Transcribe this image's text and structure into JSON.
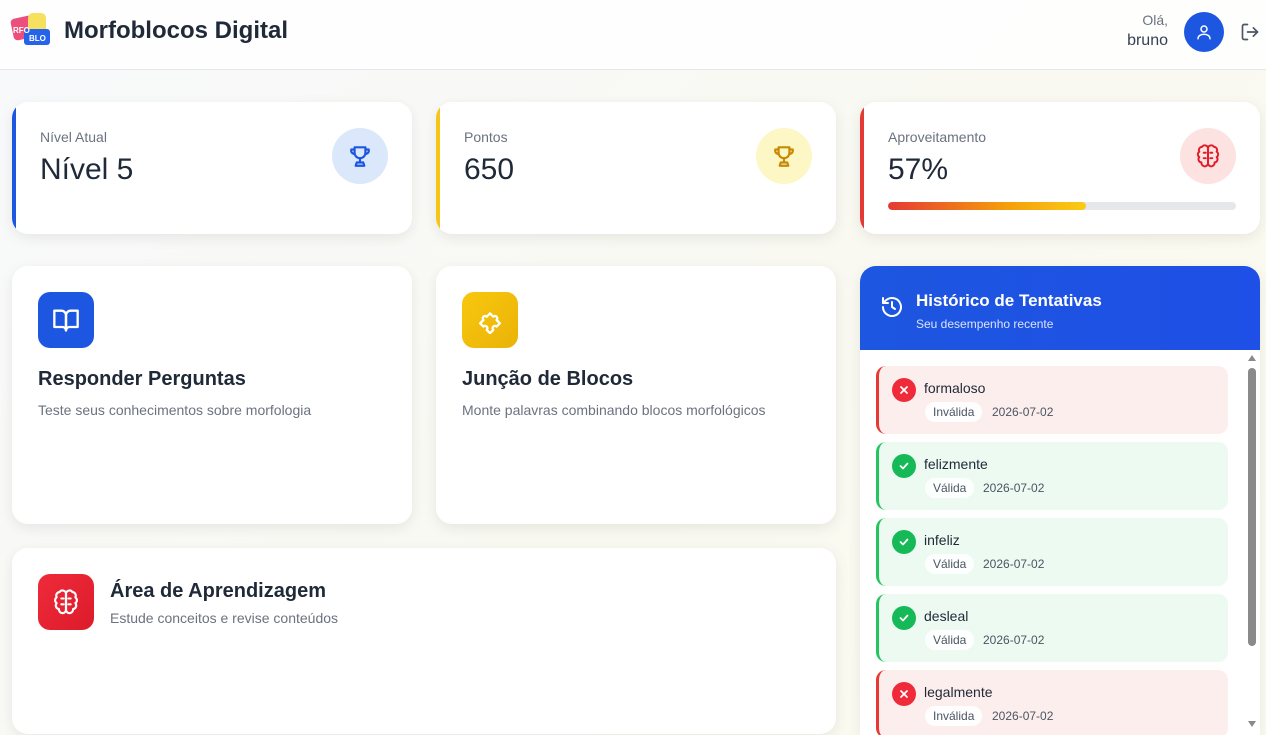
{
  "header": {
    "app_title": "Morfoblocos Digital",
    "greeting": "Olá,",
    "username": "bruno",
    "logo_icon": "morfoblocos-logo",
    "avatar_icon": "user-icon",
    "logout_icon": "logout-icon"
  },
  "stats": [
    {
      "label": "Nível Atual",
      "value": "Nível 5",
      "icon": "trophy-icon",
      "accent": "#1d56e0"
    },
    {
      "label": "Pontos",
      "value": "650",
      "icon": "trophy-icon",
      "accent": "#f5c518"
    },
    {
      "label": "Aproveitamento",
      "value": "57%",
      "icon": "brain-icon",
      "accent": "#e53935",
      "progress": 0.57
    }
  ],
  "cards": {
    "questions": {
      "title": "Responder Perguntas",
      "desc": "Teste seus conhecimentos sobre morfologia",
      "icon": "book-icon"
    },
    "blocks": {
      "title": "Junção de Blocos",
      "desc": "Monte palavras combinando blocos morfológicos",
      "icon": "puzzle-icon"
    },
    "learning": {
      "title": "Área de Aprendizagem",
      "desc": "Estude conceitos e revise conteúdos",
      "icon": "brain-icon"
    }
  },
  "history": {
    "title": "Histórico de Tentativas",
    "subtitle": "Seu desempenho recente",
    "icon": "history-icon",
    "entries": [
      {
        "word": "formaloso",
        "status": "Inválida",
        "date": "2026-07-02",
        "valid": false
      },
      {
        "word": "felizmente",
        "status": "Válida",
        "date": "2026-07-02",
        "valid": true
      },
      {
        "word": "infeliz",
        "status": "Válida",
        "date": "2026-07-02",
        "valid": true
      },
      {
        "word": "desleal",
        "status": "Válida",
        "date": "2026-07-02",
        "valid": true
      },
      {
        "word": "legalmente",
        "status": "Inválida",
        "date": "2026-07-02",
        "valid": false
      }
    ]
  },
  "colors": {
    "primary": "#1d56e0",
    "warning": "#f5c518",
    "danger": "#e53935",
    "success": "#16b957"
  }
}
